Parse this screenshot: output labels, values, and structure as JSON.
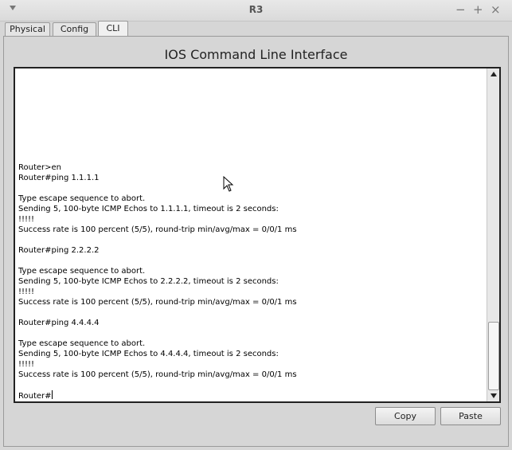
{
  "window": {
    "title": "R3",
    "controls": {
      "minimize": "−",
      "maximize": "+",
      "close": "×"
    }
  },
  "tabs": [
    {
      "label": "Physical",
      "active": false
    },
    {
      "label": "Config",
      "active": false
    },
    {
      "label": "CLI",
      "active": true
    }
  ],
  "cli": {
    "header": "IOS Command Line Interface",
    "lines": [
      "Router>en",
      "Router#ping 1.1.1.1",
      "",
      "Type escape sequence to abort.",
      "Sending 5, 100-byte ICMP Echos to 1.1.1.1, timeout is 2 seconds:",
      "!!!!!",
      "Success rate is 100 percent (5/5), round-trip min/avg/max = 0/0/1 ms",
      "",
      "Router#ping 2.2.2.2",
      "",
      "Type escape sequence to abort.",
      "Sending 5, 100-byte ICMP Echos to 2.2.2.2, timeout is 2 seconds:",
      "!!!!!",
      "Success rate is 100 percent (5/5), round-trip min/avg/max = 0/0/1 ms",
      "",
      "Router#ping 4.4.4.4",
      "",
      "Type escape sequence to abort.",
      "Sending 5, 100-byte ICMP Echos to 4.4.4.4, timeout is 2 seconds:",
      "!!!!!",
      "Success rate is 100 percent (5/5), round-trip min/avg/max = 0/0/1 ms",
      ""
    ],
    "prompt": "Router#"
  },
  "buttons": {
    "copy": "Copy",
    "paste": "Paste"
  }
}
